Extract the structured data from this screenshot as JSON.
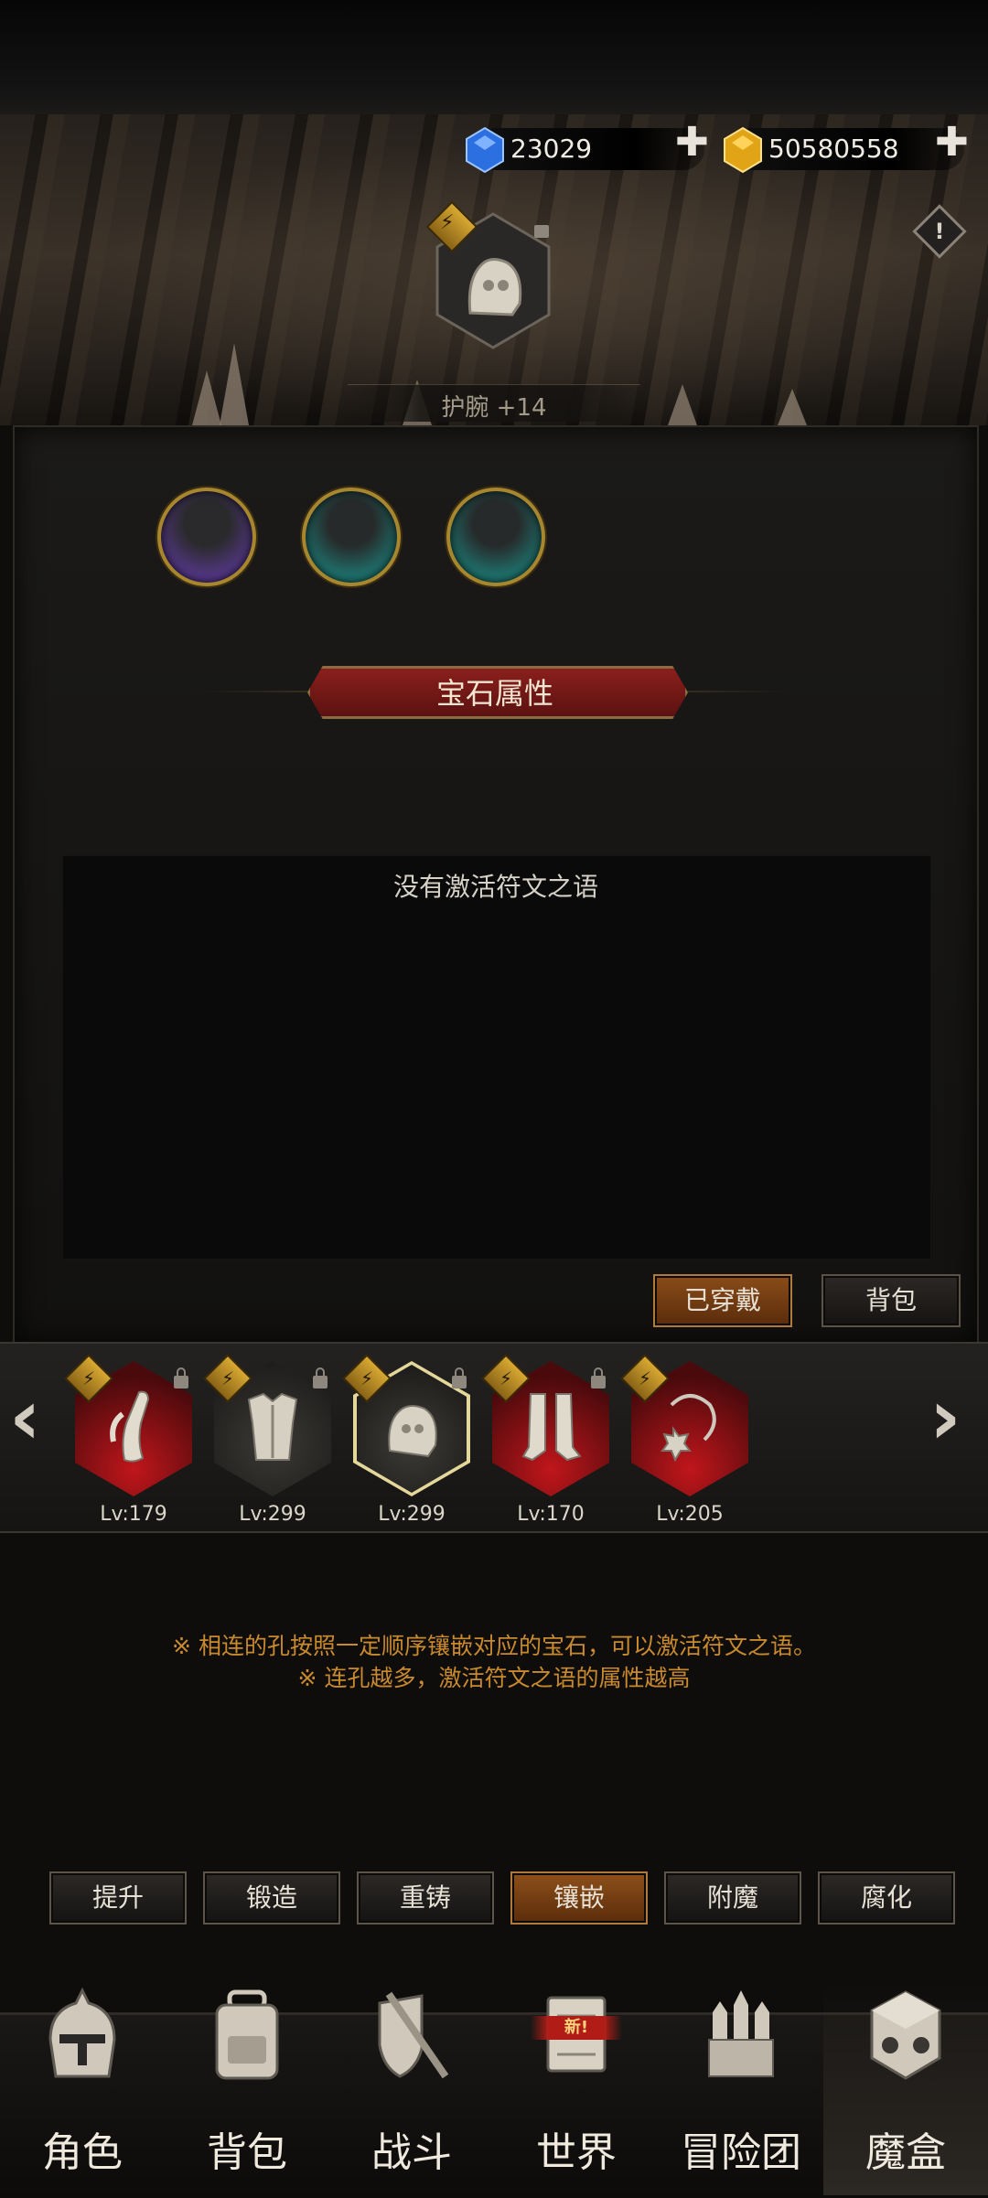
{
  "status": {
    "time_dim": ""
  },
  "header": {
    "gems": "23029",
    "gold": "50580558",
    "item_label": "护腕 +14"
  },
  "panel": {
    "section_title": "宝石属性",
    "rune_status": "没有激活符文之语",
    "equipped_btn": "已穿戴",
    "bag_btn": "背包"
  },
  "equipment": [
    {
      "level": "Lv:179",
      "icon": "bracer-cloth-icon",
      "frame": "red"
    },
    {
      "level": "Lv:299",
      "icon": "chest-armor-icon",
      "frame": "gray"
    },
    {
      "level": "Lv:299",
      "icon": "gauntlet-icon",
      "frame": "selected"
    },
    {
      "level": "Lv:170",
      "icon": "boots-icon",
      "frame": "red"
    },
    {
      "level": "Lv:205",
      "icon": "necklace-icon",
      "frame": "red"
    }
  ],
  "hints": {
    "line1": "※ 相连的孔按照一定顺序镶嵌对应的宝石，可以激活符文之语。",
    "line2": "※ 连孔越多，激活符文之语的属性越高"
  },
  "modes": [
    "提升",
    "锻造",
    "重铸",
    "镶嵌",
    "附魔",
    "腐化"
  ],
  "active_mode": "镶嵌",
  "nav": {
    "items": [
      "角色",
      "背包",
      "战斗",
      "世界",
      "冒险团",
      "魔盒"
    ],
    "new_badge": "新!",
    "active": "魔盒"
  },
  "colors": {
    "accent_gold": "#c98a2e",
    "active_orange": "#8a4c18",
    "banner_red": "#8a1f1c"
  }
}
